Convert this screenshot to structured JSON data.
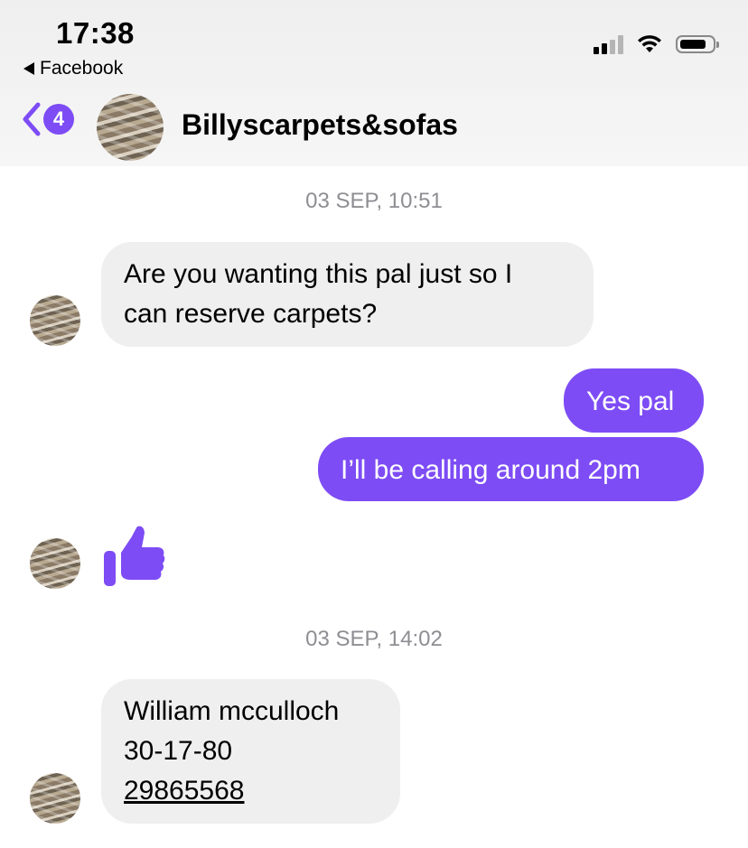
{
  "status_bar": {
    "time": "17:38",
    "back_app": "Facebook"
  },
  "header": {
    "unread_count": "4",
    "contact_name": "Billyscarpets&sofas"
  },
  "conversation": {
    "timestamps": [
      "03 SEP, 10:51",
      "03 SEP, 14:02"
    ],
    "incoming_1": [
      "Are you wanting this pal just so I",
      "can reserve carpets?"
    ],
    "outgoing_1": "Yes pal",
    "outgoing_2": "I’ll be calling around 2pm",
    "reaction_icon": "thumbs-up-icon",
    "incoming_2": {
      "name": "William mcculloch",
      "sort_code": "30-17-80",
      "account_number": "29865568"
    }
  },
  "colors": {
    "accent": "#7d4cf5",
    "incoming_bubble": "#efefef",
    "timestamp": "#8e8e93"
  }
}
